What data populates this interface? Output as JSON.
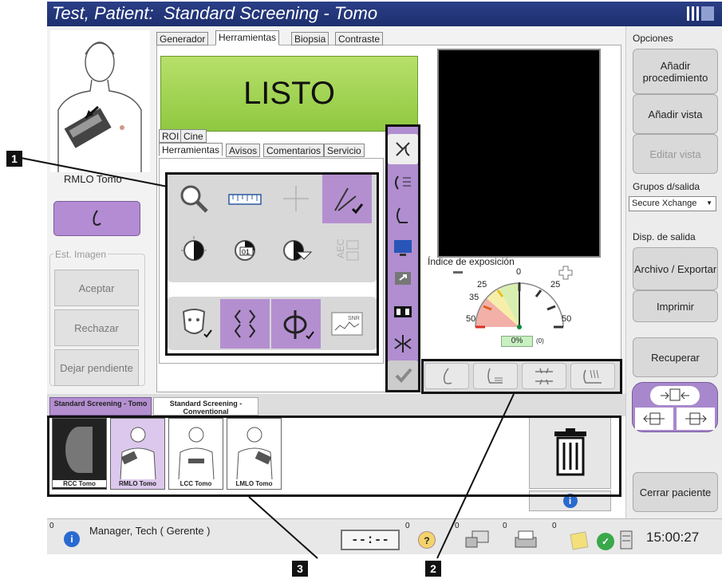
{
  "title": "Test, Patient:  Standard Screening - Tomo",
  "tabs_top": [
    "Generador",
    "Herramientas",
    "Biopsia",
    "Contraste"
  ],
  "status_display": "LISTO",
  "subtabs_row1": [
    "ROI",
    "Cine"
  ],
  "subtabs_row2": [
    "Herramientas",
    "Avisos",
    "Comentarios",
    "Servicio"
  ],
  "view_label": "RMLO Tomo",
  "image_status": {
    "legend": "Est. Imagen",
    "accept": "Aceptar",
    "reject": "Rechazar",
    "pending": "Dejar pendiente"
  },
  "exposure": {
    "title": "Índice de exposición",
    "ticks": [
      "0",
      "25",
      "25",
      "35",
      "50",
      "50"
    ],
    "value": "0%",
    "count": "(0)"
  },
  "right": {
    "options_label": "Opciones",
    "add_procedure": "Añadir procedimiento",
    "add_view": "Añadir vista",
    "edit_view": "Editar vista",
    "output_groups_label": "Grupos d/salida",
    "output_group_value": "Secure Xchange",
    "output_devices_label": "Disp. de salida",
    "archive_export": "Archivo / Exportar",
    "print": "Imprimir",
    "retrieve": "Recuperar",
    "close_patient": "Cerrar paciente"
  },
  "procedure_tabs": [
    "Standard Screening - Tomo",
    "Standard Screening - Conventional"
  ],
  "thumbnails": [
    "RCC Tomo",
    "RMLO Tomo",
    "LCC Tomo",
    "LMLO Tomo"
  ],
  "statusbar": {
    "count0": "0",
    "user": "Manager, Tech ( Gerente )",
    "timer": "--:--",
    "c1": "0",
    "c2": "0",
    "c3": "0",
    "c4": "0",
    "time": "15:00:27"
  },
  "callouts": [
    "1",
    "2",
    "3"
  ]
}
